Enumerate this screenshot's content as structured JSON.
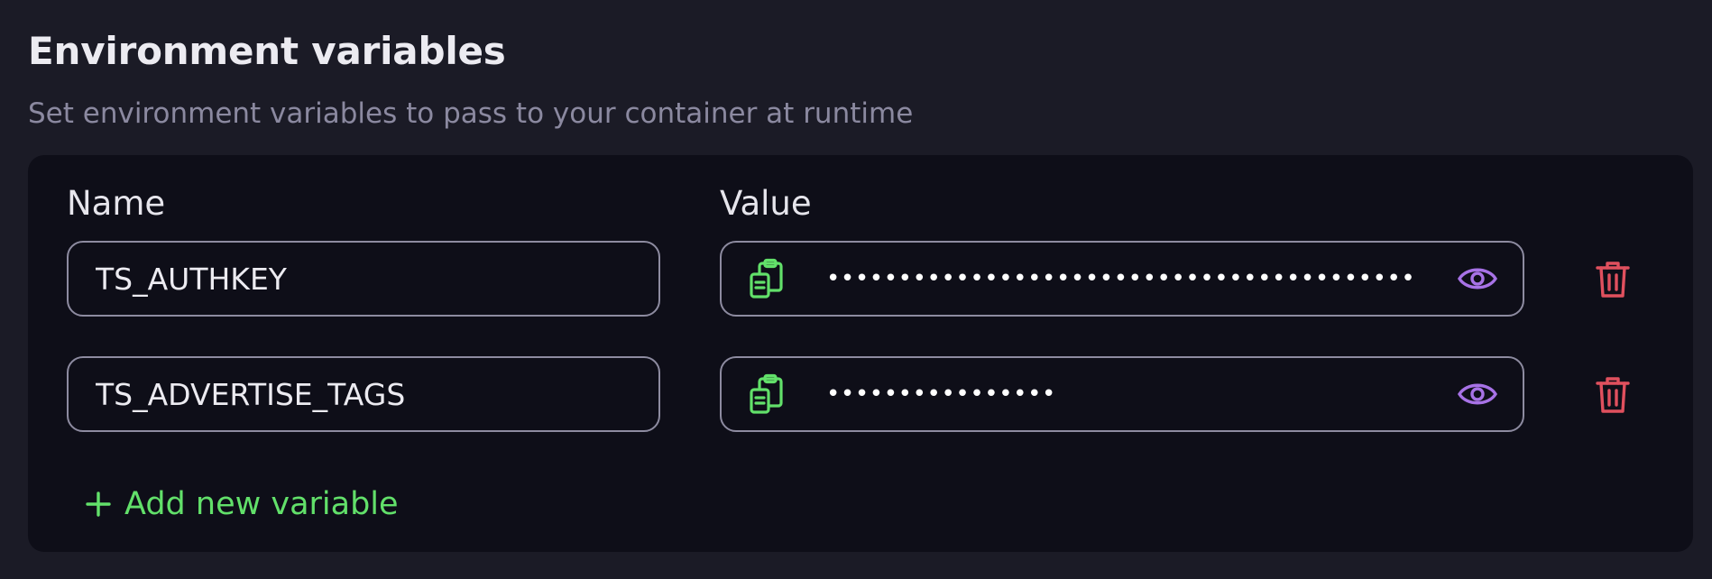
{
  "section": {
    "title": "Environment variables",
    "description": "Set environment variables to pass to your container at runtime"
  },
  "table": {
    "name_header": "Name",
    "value_header": "Value"
  },
  "variables": [
    {
      "name": "TS_AUTHKEY",
      "masked_value": "•••••••••••••••••••••••••••••••••••••••••••••••••••••••••••••"
    },
    {
      "name": "TS_ADVERTISE_TAGS",
      "masked_value": "••••••••••••••••"
    }
  ],
  "add_button": {
    "label": "Add new variable"
  },
  "colors": {
    "copy_icon": "#62e06a",
    "eye_icon": "#a772e6",
    "trash_icon": "#e0505e",
    "add_text": "#62e06a"
  }
}
